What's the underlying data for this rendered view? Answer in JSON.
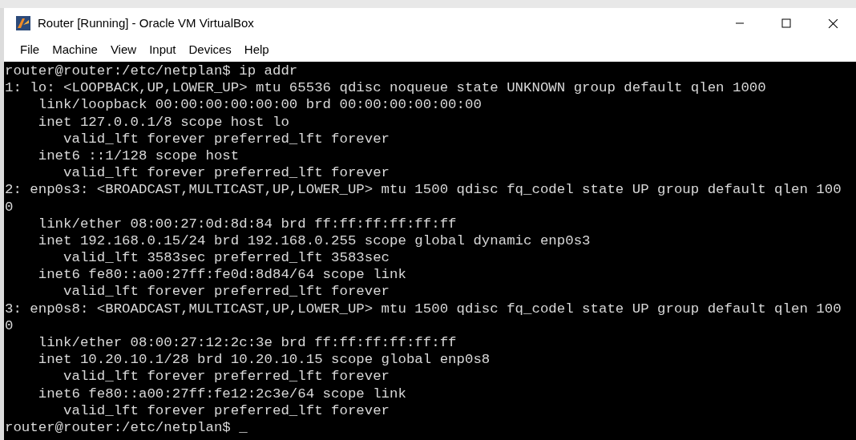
{
  "window": {
    "title": "Router [Running] - Oracle VM VirtualBox"
  },
  "menu": [
    "File",
    "Machine",
    "View",
    "Input",
    "Devices",
    "Help"
  ],
  "terminal": {
    "lines": [
      "router@router:/etc/netplan$ ip addr",
      "1: lo: <LOOPBACK,UP,LOWER_UP> mtu 65536 qdisc noqueue state UNKNOWN group default qlen 1000",
      "    link/loopback 00:00:00:00:00:00 brd 00:00:00:00:00:00",
      "    inet 127.0.0.1/8 scope host lo",
      "       valid_lft forever preferred_lft forever",
      "    inet6 ::1/128 scope host",
      "       valid_lft forever preferred_lft forever",
      "2: enp0s3: <BROADCAST,MULTICAST,UP,LOWER_UP> mtu 1500 qdisc fq_codel state UP group default qlen 100",
      "0",
      "    link/ether 08:00:27:0d:8d:84 brd ff:ff:ff:ff:ff:ff",
      "    inet 192.168.0.15/24 brd 192.168.0.255 scope global dynamic enp0s3",
      "       valid_lft 3583sec preferred_lft 3583sec",
      "    inet6 fe80::a00:27ff:fe0d:8d84/64 scope link",
      "       valid_lft forever preferred_lft forever",
      "3: enp0s8: <BROADCAST,MULTICAST,UP,LOWER_UP> mtu 1500 qdisc fq_codel state UP group default qlen 100",
      "0",
      "    link/ether 08:00:27:12:2c:3e brd ff:ff:ff:ff:ff:ff",
      "    inet 10.20.10.1/28 brd 10.20.10.15 scope global enp0s8",
      "       valid_lft forever preferred_lft forever",
      "    inet6 fe80::a00:27ff:fe12:2c3e/64 scope link",
      "       valid_lft forever preferred_lft forever",
      "router@router:/etc/netplan$ _"
    ]
  }
}
